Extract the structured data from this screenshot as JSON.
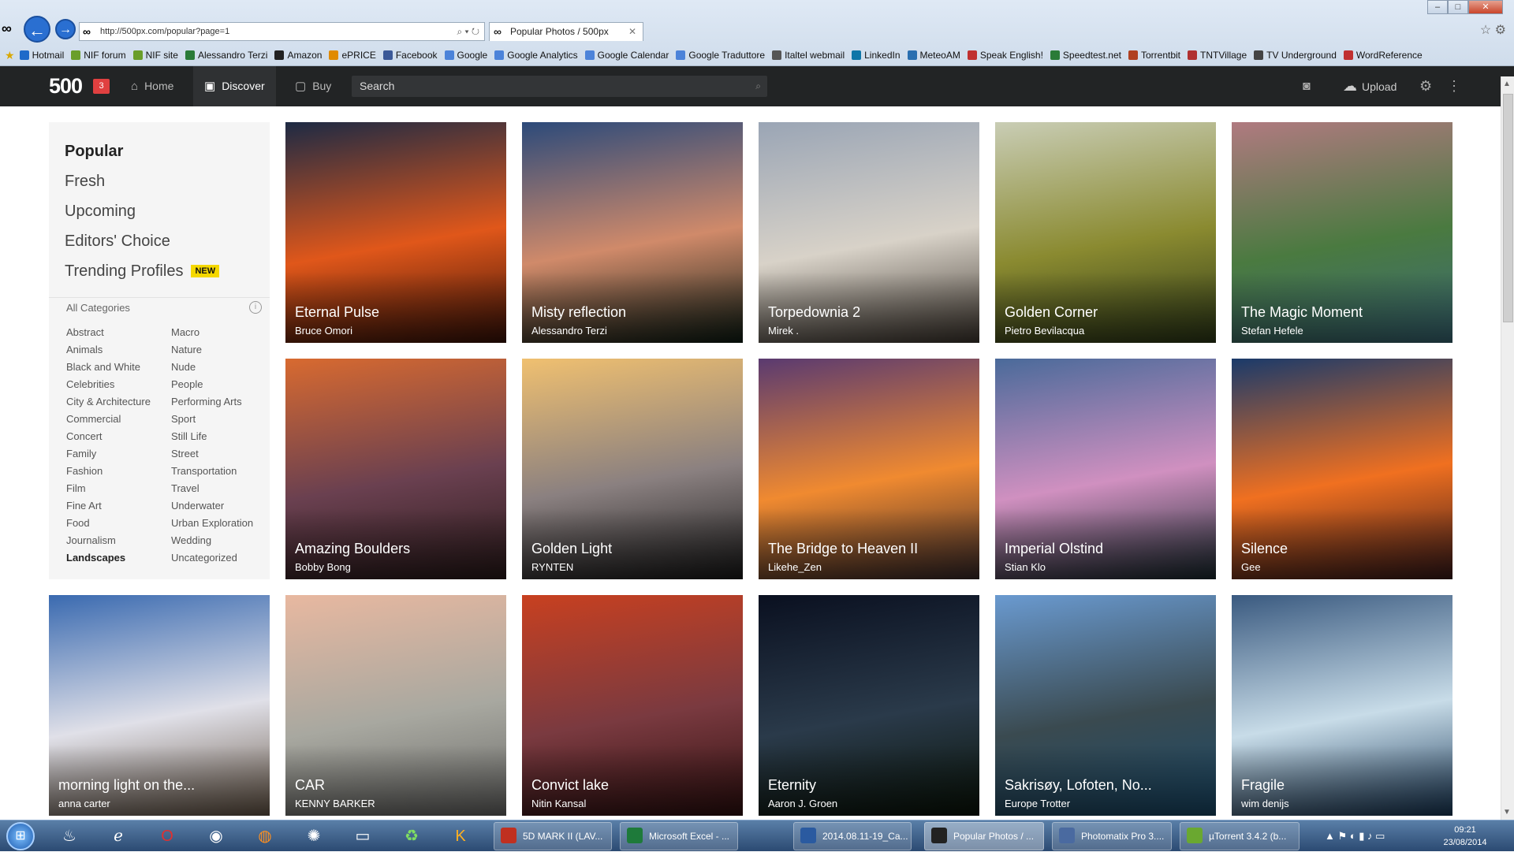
{
  "browser": {
    "url": "http://500px.com/popular?page=1",
    "tab_title": "Popular Photos / 500px",
    "tab_close": "✕",
    "favorites": [
      {
        "label": "Hotmail",
        "color": "#1e6ac9"
      },
      {
        "label": "NIF forum",
        "color": "#6a9e2a"
      },
      {
        "label": "NIF site",
        "color": "#6a9e2a"
      },
      {
        "label": "Alessandro Terzi",
        "color": "#2a7b38"
      },
      {
        "label": "Amazon",
        "color": "#222222"
      },
      {
        "label": "ePRICE",
        "color": "#e08a00"
      },
      {
        "label": "Facebook",
        "color": "#3b5998"
      },
      {
        "label": "Google",
        "color": "#4c83d9"
      },
      {
        "label": "Google Analytics",
        "color": "#4c83d9"
      },
      {
        "label": "Google Calendar",
        "color": "#4c83d9"
      },
      {
        "label": "Google Traduttore",
        "color": "#4c83d9"
      },
      {
        "label": "Italtel webmail",
        "color": "#555555"
      },
      {
        "label": "LinkedIn",
        "color": "#0e76a8"
      },
      {
        "label": "MeteoAM",
        "color": "#2a6fb0"
      },
      {
        "label": "Speak English!",
        "color": "#c03030"
      },
      {
        "label": "Speedtest.net",
        "color": "#2a7b38"
      },
      {
        "label": "Torrentbit",
        "color": "#b04020"
      },
      {
        "label": "TNTVillage",
        "color": "#b03030"
      },
      {
        "label": "TV Underground",
        "color": "#444444"
      },
      {
        "label": "WordReference",
        "color": "#c03030"
      }
    ]
  },
  "site": {
    "logo": "500",
    "notifications": "3",
    "nav": [
      {
        "label": "Home",
        "icon": "home-icon",
        "active": false
      },
      {
        "label": "Discover",
        "icon": "image-icon",
        "active": true
      },
      {
        "label": "Buy",
        "icon": "shopping-bag-icon",
        "active": false
      }
    ],
    "search_placeholder": "Search",
    "upload_label": "Upload"
  },
  "sidebar": {
    "filters": [
      {
        "label": "Popular",
        "selected": true
      },
      {
        "label": "Fresh",
        "selected": false
      },
      {
        "label": "Upcoming",
        "selected": false
      },
      {
        "label": "Editors' Choice",
        "selected": false
      },
      {
        "label": "Trending Profiles",
        "selected": false,
        "badge": "NEW"
      }
    ],
    "categories_title": "All Categories",
    "categories_col1": [
      "Abstract",
      "Animals",
      "Black and White",
      "Celebrities",
      "City & Architecture",
      "Commercial",
      "Concert",
      "Family",
      "Fashion",
      "Film",
      "Fine Art",
      "Food",
      "Journalism",
      "Landscapes"
    ],
    "categories_col2": [
      "Macro",
      "Nature",
      "Nude",
      "People",
      "Performing Arts",
      "Sport",
      "Still Life",
      "Street",
      "Transportation",
      "Travel",
      "Underwater",
      "Urban Exploration",
      "Wedding",
      "Uncategorized"
    ],
    "selected_category": "Landscapes"
  },
  "photos": [
    {
      "title": "Eternal Pulse",
      "author": "Bruce Omori",
      "colors": [
        "#1d2a44",
        "#e0571a",
        "#3a1208"
      ]
    },
    {
      "title": "Misty reflection",
      "author": "Alessandro Terzi",
      "colors": [
        "#2c4a7a",
        "#d08a6a",
        "#0e1d14"
      ]
    },
    {
      "title": "Torpedownia 2",
      "author": "Mirek .",
      "colors": [
        "#9aa5b5",
        "#d8d2c8",
        "#403830"
      ]
    },
    {
      "title": "Golden Corner",
      "author": "Pietro Bevilacqua",
      "colors": [
        "#c9cdb5",
        "#8a8a30",
        "#2e3a18"
      ]
    },
    {
      "title": "The Magic Moment",
      "author": "Stefan Hefele",
      "colors": [
        "#b07a80",
        "#4a7a40",
        "#3a6a78"
      ]
    },
    {
      "title": "Amazing Boulders",
      "author": "Bobby Bong",
      "colors": [
        "#d86a30",
        "#6a4050",
        "#2a1a1a"
      ]
    },
    {
      "title": "Golden Light",
      "author": "RYNTEN",
      "colors": [
        "#f0c070",
        "#8a8080",
        "#1a1a1a"
      ]
    },
    {
      "title": "The Bridge to Heaven II",
      "author": "Likehe_Zen",
      "colors": [
        "#5a3a70",
        "#f08a30",
        "#3a2a2a"
      ]
    },
    {
      "title": "Imperial Olstind",
      "author": "Stian Klo",
      "colors": [
        "#4a6a9a",
        "#d090c0",
        "#1a2a30"
      ]
    },
    {
      "title": "Silence",
      "author": "Gee",
      "colors": [
        "#1a3a6a",
        "#f07020",
        "#3a1a1a"
      ]
    },
    {
      "title": "morning light on the...",
      "author": "anna carter",
      "colors": [
        "#3a6ab0",
        "#e0e0e8",
        "#6a5a4a"
      ]
    },
    {
      "title": "CAR",
      "author": "KENNY BARKER",
      "colors": [
        "#e8b8a0",
        "#a8a8a0",
        "#6a6a68"
      ]
    },
    {
      "title": "Convict lake",
      "author": "Nitin Kansal",
      "colors": [
        "#c84020",
        "#7a3a40",
        "#301010"
      ]
    },
    {
      "title": "Eternity",
      "author": "Aaron J. Groen",
      "colors": [
        "#0a1020",
        "#2a3a4a",
        "#0a1408"
      ]
    },
    {
      "title": "Sakrisøy, Lofoten, No...",
      "author": "Europe Trotter",
      "colors": [
        "#6a9ad0",
        "#3a4a50",
        "#1a4a6a"
      ]
    },
    {
      "title": "Fragile",
      "author": "wim denijs",
      "colors": [
        "#3a5a80",
        "#c8dce8",
        "#1a3a5a"
      ]
    }
  ],
  "taskbar": {
    "tasks": [
      {
        "label": "5D MARK II (LAV...",
        "color": "#c03020"
      },
      {
        "label": "Microsoft Excel - ...",
        "color": "#1e7a3a"
      },
      {
        "label": "2014.08.11-19_Ca...",
        "color": "#2a5aa0"
      },
      {
        "label": "Popular Photos / ...",
        "color": "#222222"
      },
      {
        "label": "Photomatix Pro 3....",
        "color": "#4a6aa0"
      },
      {
        "label": "µTorrent 3.4.2  (b...",
        "color": "#6aa830"
      }
    ],
    "time": "09:21",
    "date": "23/08/2014"
  }
}
